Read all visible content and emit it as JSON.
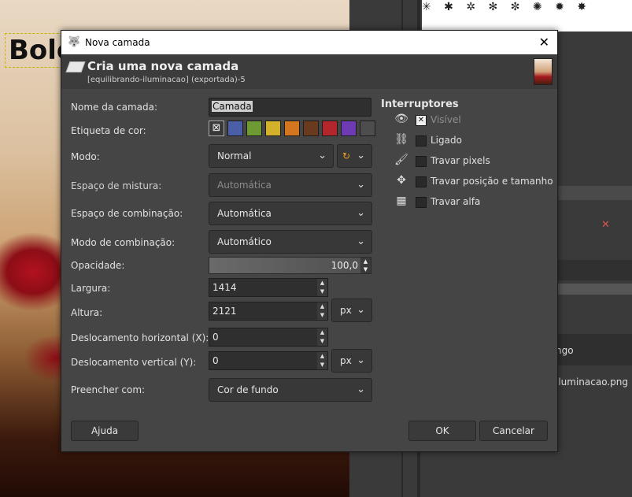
{
  "background": {
    "canvas_text": "Bolo",
    "layer_name_partial": "ngo",
    "layer_file_partial": "iluminacao.png",
    "brush_row": "✳ ✱ ✲ ✻ ✼ ✺ ✹ ✸"
  },
  "dialog": {
    "title": "Nova camada",
    "heading": "Cria uma nova camada",
    "subtitle": "[equilibrando-iluminacao] (exportada)-5",
    "labels": {
      "layer_name": "Nome da camada:",
      "color_tag": "Etiqueta de cor:",
      "mode": "Modo:",
      "blend_space": "Espaço de mistura:",
      "composite_space": "Espaço de combinação:",
      "composite_mode": "Modo de combinação:",
      "opacity": "Opacidade:",
      "width": "Largura:",
      "height": "Altura:",
      "offset_x": "Deslocamento horizontal (X):",
      "offset_y": "Deslocamento vertical (Y):",
      "fill": "Preencher com:"
    },
    "values": {
      "layer_name": "Camada",
      "mode": "Normal",
      "blend_space": "Automática",
      "composite_space": "Automática",
      "composite_mode": "Automático",
      "opacity": "100,0",
      "width": "1414",
      "height": "2121",
      "offset_x": "0",
      "offset_y": "0",
      "size_unit": "px",
      "offset_unit": "px",
      "fill": "Cor de fundo"
    },
    "color_tags": [
      "#3a3a3a",
      "#4a5fa8",
      "#6d9a33",
      "#d4b12b",
      "#d4761f",
      "#6a3a1e",
      "#b3262b",
      "#6e3bb5",
      "#4d4d4d"
    ],
    "switches_title": "Interruptores",
    "switches": [
      {
        "label": "Visível",
        "checked": true,
        "icon": "eye-icon",
        "glyph": "👁"
      },
      {
        "label": "Ligado",
        "checked": false,
        "icon": "chain-icon",
        "glyph": "⛓"
      },
      {
        "label": "Travar pixels",
        "checked": false,
        "icon": "brush-icon",
        "glyph": "🖌"
      },
      {
        "label": "Travar posição e tamanho",
        "checked": false,
        "icon": "move-icon",
        "glyph": "✥"
      },
      {
        "label": "Travar alfa",
        "checked": false,
        "icon": "checkerboard-icon",
        "glyph": "▦"
      }
    ],
    "buttons": {
      "help": "Ajuda",
      "ok": "OK",
      "cancel": "Cancelar"
    }
  }
}
